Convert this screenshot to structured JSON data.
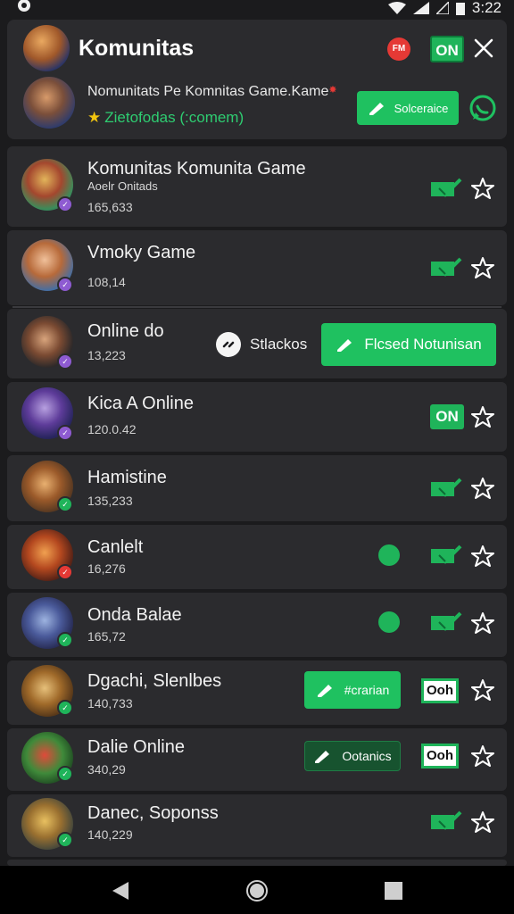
{
  "status_bar": {
    "time": "3:22"
  },
  "header": {
    "title": "Komunitas",
    "fm_badge": "FM",
    "on_toggle": "ON",
    "subtitle": "Nomunitats Pe Komnitas Game.Kame",
    "highlight": "Zietofodas (:comem)",
    "action_button": "Solceraice"
  },
  "items": [
    {
      "title": "Komunitas Komunita Game",
      "subtitle": "Aoelr Onitads",
      "count": "165,633",
      "badge": "purple",
      "right": "check"
    },
    {
      "title": "Vmoky Game",
      "count": "108,14",
      "badge": "purple",
      "right": "check"
    },
    {
      "title": "Online do",
      "count": "13,223",
      "badge": "purple",
      "extra_label": "Stlackos",
      "action_button": "Flcsed Notunisan"
    },
    {
      "title": "Kica A Online",
      "count": "120.0.42",
      "badge": "purple",
      "right": "on",
      "right_label": "ON"
    },
    {
      "title": "Hamistine",
      "count": "135,233",
      "badge": "green",
      "right": "check"
    },
    {
      "title": "Canlelt",
      "count": "16,276",
      "badge": "red",
      "right": "check"
    },
    {
      "title": "Onda Balae",
      "count": "165,72",
      "badge": "green",
      "right": "check"
    },
    {
      "title": "Dgachi, Slenlbes",
      "count": "140,733",
      "badge": "green",
      "action_button": "#crarian",
      "right": "oh",
      "right_label": "Ooh"
    },
    {
      "title": "Dalie Online",
      "count": "340,29",
      "badge": "green",
      "action_button": "Ootanics",
      "right": "oh",
      "right_label": "Ooh"
    },
    {
      "title": "Danec, Soponss",
      "count": "140,229",
      "badge": "green",
      "right": "check"
    }
  ],
  "colors": {
    "accent": "#1fc160",
    "background": "#1b1b1d",
    "card": "#2b2b2e"
  }
}
